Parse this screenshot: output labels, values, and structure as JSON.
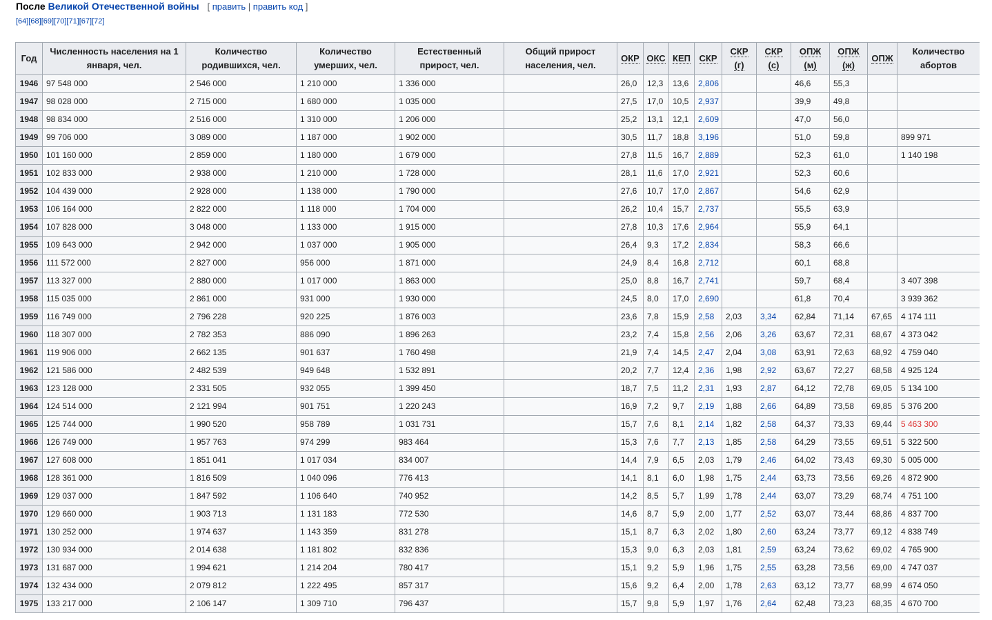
{
  "section": {
    "title_prefix": "После",
    "title_link": "Великой Отечественной войны",
    "edit_open": "[",
    "edit_link": "править",
    "edit_sep": "|",
    "edit_code_link": "править код",
    "edit_close": "]"
  },
  "refs": "[64][68][69][70][71][67][72]",
  "table": {
    "headers": [
      "Год",
      "Численность населения на 1 января, чел.",
      "Количество родившихся, чел.",
      "Количество умерших, чел.",
      "Естественный прирост, чел.",
      "Общий прирост населения, чел.",
      "ОКР",
      "ОКС",
      "КЕП",
      "СКР",
      "СКР (г)",
      "СКР (с)",
      "ОПЖ (м)",
      "ОПЖ (ж)",
      "ОПЖ",
      "Количество абортов"
    ],
    "rows": [
      [
        "1946",
        "97 548 000",
        "2 546 000",
        "1 210 000",
        "1 336 000",
        "",
        "26,0",
        "12,3",
        "13,6",
        "2,806",
        "",
        "",
        "46,6",
        "55,3",
        "",
        ""
      ],
      [
        "1947",
        "98 028 000",
        "2 715 000",
        "1 680 000",
        "1 035 000",
        "",
        "27,5",
        "17,0",
        "10,5",
        "2,937",
        "",
        "",
        "39,9",
        "49,8",
        "",
        ""
      ],
      [
        "1948",
        "98 834 000",
        "2 516 000",
        "1 310 000",
        "1 206 000",
        "",
        "25,2",
        "13,1",
        "12,1",
        "2,609",
        "",
        "",
        "47,0",
        "56,0",
        "",
        ""
      ],
      [
        "1949",
        "99 706 000",
        "3 089 000",
        "1 187 000",
        "1 902 000",
        "",
        "30,5",
        "11,7",
        "18,8",
        "3,196",
        "",
        "",
        "51,0",
        "59,8",
        "",
        "899 971"
      ],
      [
        "1950",
        "101 160 000",
        "2 859 000",
        "1 180 000",
        "1 679 000",
        "",
        "27,8",
        "11,5",
        "16,7",
        "2,889",
        "",
        "",
        "52,3",
        "61,0",
        "",
        "1 140 198"
      ],
      [
        "1951",
        "102 833 000",
        "2 938 000",
        "1 210 000",
        "1 728 000",
        "",
        "28,1",
        "11,6",
        "17,0",
        "2,921",
        "",
        "",
        "52,3",
        "60,6",
        "",
        ""
      ],
      [
        "1952",
        "104 439 000",
        "2 928 000",
        "1 138 000",
        "1 790 000",
        "",
        "27,6",
        "10,7",
        "17,0",
        "2,867",
        "",
        "",
        "54,6",
        "62,9",
        "",
        ""
      ],
      [
        "1953",
        "106 164 000",
        "2 822 000",
        "1 118 000",
        "1 704 000",
        "",
        "26,2",
        "10,4",
        "15,7",
        "2,737",
        "",
        "",
        "55,5",
        "63,9",
        "",
        ""
      ],
      [
        "1954",
        "107 828 000",
        "3 048 000",
        "1 133 000",
        "1 915 000",
        "",
        "27,8",
        "10,3",
        "17,6",
        "2,964",
        "",
        "",
        "55,9",
        "64,1",
        "",
        ""
      ],
      [
        "1955",
        "109 643 000",
        "2 942 000",
        "1 037 000",
        "1 905 000",
        "",
        "26,4",
        "9,3",
        "17,2",
        "2,834",
        "",
        "",
        "58,3",
        "66,6",
        "",
        ""
      ],
      [
        "1956",
        "111 572 000",
        "2 827 000",
        "956 000",
        "1 871 000",
        "",
        "24,9",
        "8,4",
        "16,8",
        "2,712",
        "",
        "",
        "60,1",
        "68,8",
        "",
        ""
      ],
      [
        "1957",
        "113 327 000",
        "2 880 000",
        "1 017 000",
        "1 863 000",
        "",
        "25,0",
        "8,8",
        "16,7",
        "2,741",
        "",
        "",
        "59,7",
        "68,4",
        "",
        "3 407 398"
      ],
      [
        "1958",
        "115 035 000",
        "2 861 000",
        "931 000",
        "1 930 000",
        "",
        "24,5",
        "8,0",
        "17,0",
        "2,690",
        "",
        "",
        "61,8",
        "70,4",
        "",
        "3 939 362"
      ],
      [
        "1959",
        "116 749 000",
        "2 796 228",
        "920 225",
        "1 876 003",
        "",
        "23,6",
        "7,8",
        "15,9",
        "2,58",
        "2,03",
        "3,34",
        "62,84",
        "71,14",
        "67,65",
        "4 174 111"
      ],
      [
        "1960",
        "118 307 000",
        "2 782 353",
        "886 090",
        "1 896 263",
        "",
        "23,2",
        "7,4",
        "15,8",
        "2,56",
        "2,06",
        "3,26",
        "63,67",
        "72,31",
        "68,67",
        "4 373 042"
      ],
      [
        "1961",
        "119 906 000",
        "2 662 135",
        "901 637",
        "1 760 498",
        "",
        "21,9",
        "7,4",
        "14,5",
        "2,47",
        "2,04",
        "3,08",
        "63,91",
        "72,63",
        "68,92",
        "4 759 040"
      ],
      [
        "1962",
        "121 586 000",
        "2 482 539",
        "949 648",
        "1 532 891",
        "",
        "20,2",
        "7,7",
        "12,4",
        "2,36",
        "1,98",
        "2,92",
        "63,67",
        "72,27",
        "68,58",
        "4 925 124"
      ],
      [
        "1963",
        "123 128 000",
        "2 331 505",
        "932 055",
        "1 399 450",
        "",
        "18,7",
        "7,5",
        "11,2",
        "2,31",
        "1,93",
        "2,87",
        "64,12",
        "72,78",
        "69,05",
        "5 134 100"
      ],
      [
        "1964",
        "124 514 000",
        "2 121 994",
        "901 751",
        "1 220 243",
        "",
        "16,9",
        "7,2",
        "9,7",
        "2,19",
        "1,88",
        "2,66",
        "64,89",
        "73,58",
        "69,85",
        "5 376 200"
      ],
      [
        "1965",
        "125 744 000",
        "1 990 520",
        "958 789",
        "1 031 731",
        "",
        "15,7",
        "7,6",
        "8,1",
        "2,14",
        "1,82",
        "2,58",
        "64,37",
        "73,33",
        "69,44",
        "5 463 300"
      ],
      [
        "1966",
        "126 749 000",
        "1 957 763",
        "974 299",
        "983 464",
        "",
        "15,3",
        "7,6",
        "7,7",
        "2,13",
        "1,85",
        "2,58",
        "64,29",
        "73,55",
        "69,51",
        "5 322 500"
      ],
      [
        "1967",
        "127 608 000",
        "1 851 041",
        "1 017 034",
        "834 007",
        "",
        "14,4",
        "7,9",
        "6,5",
        "2,03",
        "1,79",
        "2,46",
        "64,02",
        "73,43",
        "69,30",
        "5 005 000"
      ],
      [
        "1968",
        "128 361 000",
        "1 816 509",
        "1 040 096",
        "776 413",
        "",
        "14,1",
        "8,1",
        "6,0",
        "1,98",
        "1,75",
        "2,44",
        "63,73",
        "73,56",
        "69,26",
        "4 872 900"
      ],
      [
        "1969",
        "129 037 000",
        "1 847 592",
        "1 106 640",
        "740 952",
        "",
        "14,2",
        "8,5",
        "5,7",
        "1,99",
        "1,78",
        "2,44",
        "63,07",
        "73,29",
        "68,74",
        "4 751 100"
      ],
      [
        "1970",
        "129 660 000",
        "1 903 713",
        "1 131 183",
        "772 530",
        "",
        "14,6",
        "8,7",
        "5,9",
        "2,00",
        "1,77",
        "2,52",
        "63,07",
        "73,44",
        "68,86",
        "4 837 700"
      ],
      [
        "1971",
        "130 252 000",
        "1 974 637",
        "1 143 359",
        "831 278",
        "",
        "15,1",
        "8,7",
        "6,3",
        "2,02",
        "1,80",
        "2,60",
        "63,24",
        "73,77",
        "69,12",
        "4 838 749"
      ],
      [
        "1972",
        "130 934 000",
        "2 014 638",
        "1 181 802",
        "832 836",
        "",
        "15,3",
        "9,0",
        "6,3",
        "2,03",
        "1,81",
        "2,59",
        "63,24",
        "73,62",
        "69,02",
        "4 765 900"
      ],
      [
        "1973",
        "131 687 000",
        "1 994 621",
        "1 214 204",
        "780 417",
        "",
        "15,1",
        "9,2",
        "5,9",
        "1,96",
        "1,75",
        "2,55",
        "63,28",
        "73,56",
        "69,00",
        "4 747 037"
      ],
      [
        "1974",
        "132 434 000",
        "2 079 812",
        "1 222 495",
        "857 317",
        "",
        "15,6",
        "9,2",
        "6,4",
        "2,00",
        "1,78",
        "2,63",
        "63,12",
        "73,77",
        "68,99",
        "4 674 050"
      ],
      [
        "1975",
        "133 217 000",
        "2 106 147",
        "1 309 710",
        "796 437",
        "",
        "15,7",
        "9,8",
        "5,9",
        "1,97",
        "1,76",
        "2,64",
        "62,48",
        "73,23",
        "68,35",
        "4 670 700"
      ]
    ],
    "link_colored": [
      [
        0,
        9
      ],
      [
        1,
        9
      ],
      [
        2,
        9
      ],
      [
        3,
        9
      ],
      [
        4,
        9
      ],
      [
        5,
        9
      ],
      [
        6,
        9
      ],
      [
        7,
        9
      ],
      [
        8,
        9
      ],
      [
        9,
        9
      ],
      [
        10,
        9
      ],
      [
        11,
        9
      ],
      [
        12,
        9
      ],
      [
        13,
        9
      ],
      [
        13,
        11
      ],
      [
        14,
        9
      ],
      [
        14,
        11
      ],
      [
        15,
        9
      ],
      [
        15,
        11
      ],
      [
        16,
        9
      ],
      [
        16,
        11
      ],
      [
        17,
        9
      ],
      [
        17,
        11
      ],
      [
        18,
        9
      ],
      [
        18,
        11
      ],
      [
        19,
        9
      ],
      [
        19,
        11
      ],
      [
        20,
        9
      ],
      [
        20,
        11
      ],
      [
        21,
        11
      ],
      [
        22,
        11
      ],
      [
        23,
        11
      ],
      [
        24,
        11
      ],
      [
        25,
        11
      ],
      [
        26,
        11
      ],
      [
        27,
        11
      ],
      [
        28,
        11
      ],
      [
        29,
        11
      ]
    ],
    "red_cells": [
      [
        19,
        15
      ]
    ]
  },
  "colors": {
    "link": "#0645ad",
    "red": "#d33",
    "header_bg": "#eaecf0",
    "cell_bg": "#f8f9fa",
    "border": "#a2a9b1"
  }
}
